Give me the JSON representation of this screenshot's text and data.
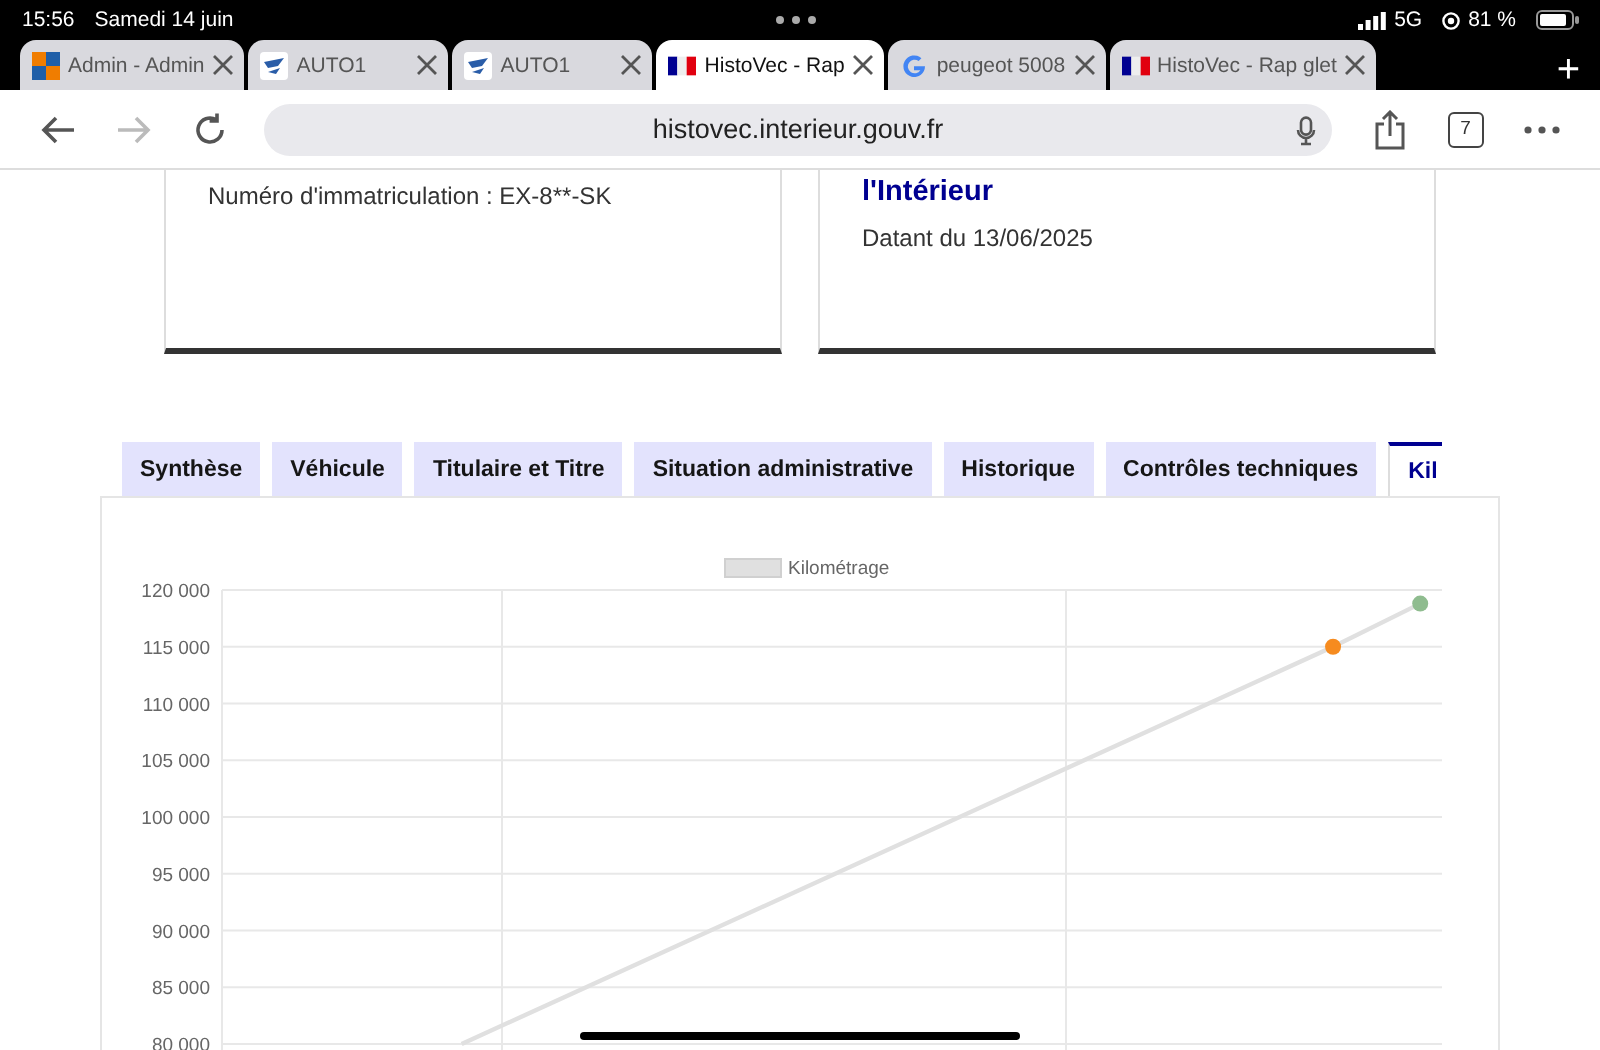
{
  "status_bar": {
    "time": "15:56",
    "date": "Samedi 14 juin",
    "network": "5G",
    "battery": "81 %"
  },
  "browser_tabs": [
    {
      "title": "Admin - Admin",
      "selected": false
    },
    {
      "title": "AUTO1",
      "selected": false
    },
    {
      "title": "AUTO1",
      "selected": false
    },
    {
      "title": "HistoVec - Rap",
      "selected": true
    },
    {
      "title": "peugeot 5008",
      "selected": false
    },
    {
      "title": "HistoVec - Rap glet",
      "selected": false
    }
  ],
  "new_tab_button": "+",
  "toolbar": {
    "url": "histovec.interieur.gouv.fr",
    "tab_count": "7"
  },
  "cards": [
    {
      "lines": [
        "Numéro d'immatriculation : EX-8**-SK"
      ]
    },
    {
      "title": "l'Intérieur",
      "lines": [
        "Datant du 13/06/2025"
      ]
    }
  ],
  "page_tabs": [
    {
      "label": "Synthèse",
      "selected": false
    },
    {
      "label": "Véhicule",
      "selected": false
    },
    {
      "label": "Titulaire et Titre",
      "selected": false
    },
    {
      "label": "Situation administrative",
      "selected": false
    },
    {
      "label": "Historique",
      "selected": false
    },
    {
      "label": "Contrôles techniques",
      "selected": false
    },
    {
      "label": "Kil",
      "selected": true
    }
  ],
  "chart_data": {
    "type": "line",
    "grid": true,
    "categories": [
      null,
      null,
      null,
      null,
      null,
      null,
      null,
      null,
      null,
      null,
      null,
      null,
      null,
      null,
      null,
      null,
      null,
      null,
      null,
      null,
      null,
      null,
      null,
      null,
      null,
      null,
      null,
      null
    ],
    "ylim": [
      80000,
      120000
    ],
    "yticks": [
      {
        "value": 80000,
        "label": "80 000"
      },
      {
        "value": 85000,
        "label": "85 000"
      },
      {
        "value": 90000,
        "label": "90 000"
      },
      {
        "value": 95000,
        "label": "95 000"
      },
      {
        "value": 100000,
        "label": "100 000"
      },
      {
        "value": 105000,
        "label": "105 000"
      },
      {
        "value": 110000,
        "label": "110 000"
      },
      {
        "value": 115000,
        "label": "115 000"
      },
      {
        "value": 120000,
        "label": "120 000"
      }
    ],
    "series": [
      {
        "name": "Kilométrage",
        "color": "#e0e0e0",
        "values": [
          null,
          null,
          null,
          null,
          null,
          80000,
          null,
          null,
          null,
          null,
          null,
          null,
          null,
          null,
          null,
          null,
          null,
          null,
          null,
          null,
          null,
          null,
          null,
          null,
          null,
          115000,
          null,
          118800
        ]
      }
    ]
  }
}
